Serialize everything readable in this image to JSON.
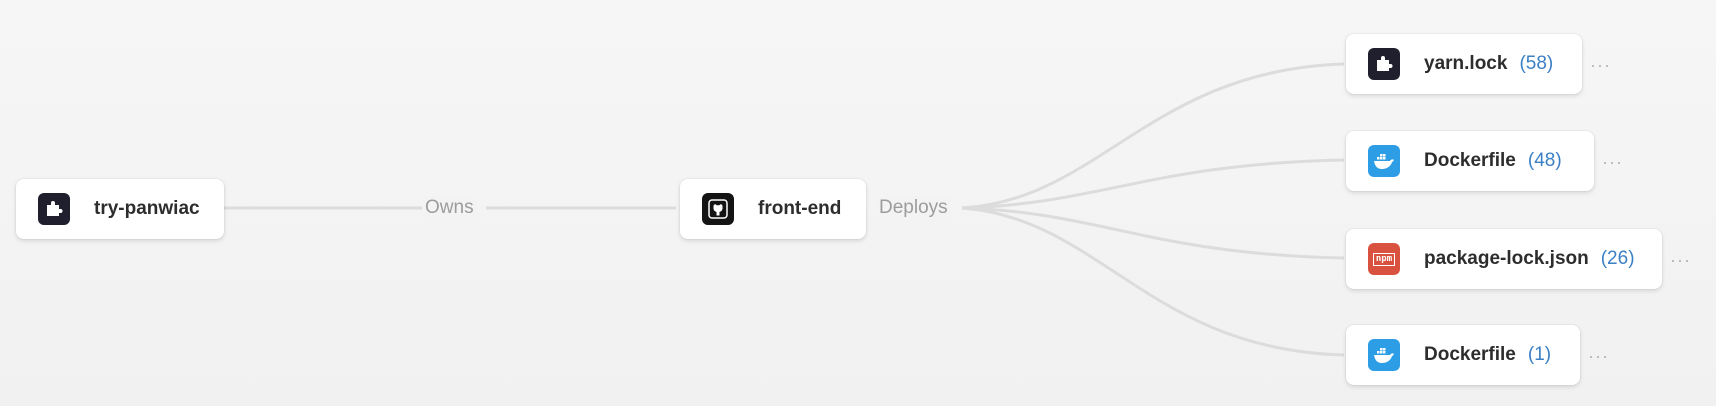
{
  "nodes": {
    "source": {
      "name": "try-panwiac",
      "icon": "puzzle-icon"
    },
    "repo": {
      "name": "front-end",
      "icon": "github-icon"
    },
    "targets": [
      {
        "name": "yarn.lock",
        "count": "(58)",
        "icon": "puzzle-icon"
      },
      {
        "name": "Dockerfile",
        "count": "(48)",
        "icon": "docker-icon"
      },
      {
        "name": "package-lock.json",
        "count": "(26)",
        "icon": "npm-icon",
        "icon_text": "npm"
      },
      {
        "name": "Dockerfile",
        "count": "(1)",
        "icon": "docker-icon"
      }
    ]
  },
  "edges": {
    "owns_label": "Owns",
    "deploys_label": "Deploys"
  },
  "more_label": "···",
  "colors": {
    "accent_count": "#3b7fc4",
    "docker": "#2d9de6",
    "npm": "#d9523f",
    "dark_icon": "#1f1f2e"
  }
}
